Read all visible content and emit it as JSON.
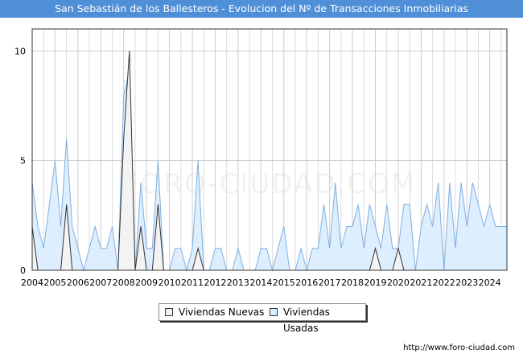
{
  "header": {
    "title": "San Sebastián de los Ballesteros - Evolucion del Nº de Transacciones Inmobiliarias"
  },
  "footer": {
    "url": "http://www.foro-ciudad.com"
  },
  "watermark": "FORO-CIUDAD.COM",
  "colors": {
    "title_bg": "#4f8fd8",
    "nuevas_fill": "#f3f3f3",
    "nuevas_line": "#333333",
    "usadas_fill": "#ddeeff",
    "usadas_line": "#7fb0e0",
    "grid": "#cccccc"
  },
  "chart_data": {
    "type": "area",
    "x_tick_labels": [
      "2004",
      "2005",
      "2006",
      "2007",
      "2008",
      "2009",
      "2010",
      "2011",
      "2012",
      "2013",
      "2014",
      "2015",
      "2016",
      "2017",
      "2018",
      "2019",
      "2020",
      "2021",
      "2022",
      "2023",
      "2024"
    ],
    "y_ticks": [
      0,
      5,
      10
    ],
    "ylim": [
      0,
      11
    ],
    "xlim": [
      2004,
      2024.75
    ],
    "grid": true,
    "legend_position": "bottom-center",
    "series": [
      {
        "name": "Viviendas Nuevas",
        "x": [
          2004,
          2004.25,
          2004.5,
          2004.75,
          2005,
          2005.25,
          2005.5,
          2005.75,
          2006,
          2006.25,
          2006.5,
          2006.75,
          2007,
          2007.25,
          2007.5,
          2007.75,
          2008,
          2008.25,
          2008.5,
          2008.75,
          2009,
          2009.25,
          2009.5,
          2009.75,
          2010,
          2010.25,
          2010.5,
          2010.75,
          2011,
          2011.25,
          2011.5,
          2011.75,
          2012,
          2012.25,
          2012.5,
          2012.75,
          2013,
          2013.25,
          2013.5,
          2013.75,
          2014,
          2014.25,
          2014.5,
          2014.75,
          2015,
          2015.25,
          2015.5,
          2015.75,
          2016,
          2016.25,
          2016.5,
          2016.75,
          2017,
          2017.25,
          2017.5,
          2017.75,
          2018,
          2018.25,
          2018.5,
          2018.75,
          2019,
          2019.25,
          2019.5,
          2019.75,
          2020,
          2020.25,
          2020.5,
          2020.75,
          2021,
          2021.25,
          2021.5,
          2021.75,
          2022,
          2022.25,
          2022.5,
          2022.75,
          2023,
          2023.25,
          2023.5,
          2023.75,
          2024,
          2024.25,
          2024.5,
          2024.75
        ],
        "values": [
          2,
          0,
          0,
          0,
          0,
          0,
          3,
          0,
          0,
          0,
          0,
          0,
          0,
          0,
          0,
          0,
          6,
          10,
          0,
          2,
          0,
          0,
          3,
          0,
          0,
          0,
          0,
          0,
          0,
          1,
          0,
          0,
          0,
          0,
          0,
          0,
          0,
          0,
          0,
          0,
          0,
          0,
          0,
          0,
          0,
          0,
          0,
          0,
          0,
          0,
          0,
          0,
          0,
          0,
          0,
          0,
          0,
          0,
          0,
          0,
          1,
          0,
          0,
          0,
          1,
          0,
          0,
          0,
          0,
          0,
          0,
          0,
          0,
          0,
          0,
          0,
          0,
          0,
          0,
          0,
          0,
          0,
          0,
          0
        ]
      },
      {
        "name": "Viviendas Usadas",
        "x": [
          2004,
          2004.25,
          2004.5,
          2004.75,
          2005,
          2005.25,
          2005.5,
          2005.75,
          2006,
          2006.25,
          2006.5,
          2006.75,
          2007,
          2007.25,
          2007.5,
          2007.75,
          2008,
          2008.25,
          2008.5,
          2008.75,
          2009,
          2009.25,
          2009.5,
          2009.75,
          2010,
          2010.25,
          2010.5,
          2010.75,
          2011,
          2011.25,
          2011.5,
          2011.75,
          2012,
          2012.25,
          2012.5,
          2012.75,
          2013,
          2013.25,
          2013.5,
          2013.75,
          2014,
          2014.25,
          2014.5,
          2014.75,
          2015,
          2015.25,
          2015.5,
          2015.75,
          2016,
          2016.25,
          2016.5,
          2016.75,
          2017,
          2017.25,
          2017.5,
          2017.75,
          2018,
          2018.25,
          2018.5,
          2018.75,
          2019,
          2019.25,
          2019.5,
          2019.75,
          2020,
          2020.25,
          2020.5,
          2020.75,
          2021,
          2021.25,
          2021.5,
          2021.75,
          2022,
          2022.25,
          2022.5,
          2022.75,
          2023,
          2023.25,
          2023.5,
          2023.75,
          2024,
          2024.25,
          2024.5,
          2024.75
        ],
        "values": [
          4,
          2,
          1,
          3,
          5,
          2,
          6,
          2,
          1,
          0,
          1,
          2,
          1,
          1,
          2,
          0,
          8,
          9,
          0,
          4,
          1,
          1,
          5,
          0,
          0,
          1,
          1,
          0,
          1,
          5,
          0,
          0,
          1,
          1,
          0,
          0,
          1,
          0,
          0,
          0,
          1,
          1,
          0,
          1,
          2,
          0,
          0,
          1,
          0,
          1,
          1,
          3,
          1,
          4,
          1,
          2,
          2,
          3,
          1,
          3,
          2,
          1,
          3,
          1,
          1,
          3,
          3,
          0,
          2,
          3,
          2,
          4,
          0,
          4,
          1,
          4,
          2,
          4,
          3,
          2,
          3,
          2,
          2,
          2
        ]
      }
    ]
  },
  "legend": {
    "nuevas_label": "Viviendas Nuevas",
    "usadas_label": "Viviendas Usadas"
  }
}
